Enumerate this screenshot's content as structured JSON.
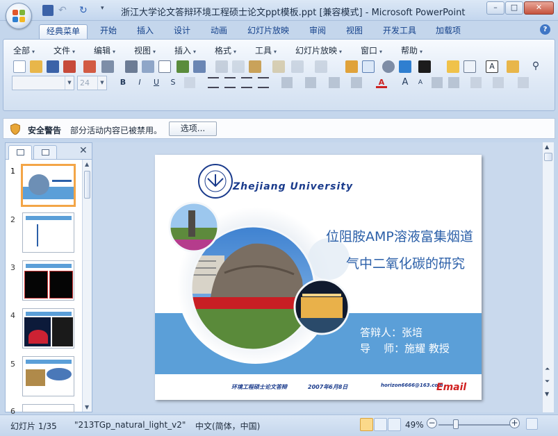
{
  "window": {
    "title": "浙江大学论文答辩环境工程硕士论文ppt模板.ppt [兼容模式] - Microsoft PowerPoint",
    "minimize": "–",
    "maximize": "□",
    "close": "✕"
  },
  "ribbon_tabs": [
    "经典菜单",
    "开始",
    "插入",
    "设计",
    "动画",
    "幻灯片放映",
    "审阅",
    "视图",
    "开发工具",
    "加载项"
  ],
  "help_glyph": "?",
  "classic_menu": [
    "全部",
    "文件",
    "编辑",
    "视图",
    "插入",
    "格式",
    "工具",
    "幻灯片放映",
    "窗口",
    "帮助"
  ],
  "font_size_field": "24",
  "format_buttons": [
    "B",
    "I",
    "U",
    "S",
    "A"
  ],
  "security_bar": {
    "title": "安全警告",
    "message": "部分活动内容已被禁用。",
    "options_button": "选项...",
    "close": "✕"
  },
  "slides_panel": {
    "close": "✕",
    "thumbnails": [
      "1",
      "2",
      "3",
      "4",
      "5",
      "6"
    ]
  },
  "slide": {
    "university": "Zhejiang University",
    "title_line1": "位阻胺AMP溶液富集烟道",
    "title_line2": "气中二氧化碳的研究",
    "defender_label": "答辩人：",
    "defender_name": "张培",
    "advisor_label": "导    师：",
    "advisor_name": "施耀 教授",
    "footer_left": "环境工程硕士论文答辩",
    "footer_date": "2007年6月8日",
    "footer_email": "horizon6666@163.com",
    "email_word": "Email"
  },
  "status_bar": {
    "slide_counter": "幻灯片 1/35",
    "theme": "\"213TGp_natural_light_v2\"",
    "language": "中文(简体，中国)",
    "zoom": "49%",
    "zoom_minus": "−",
    "zoom_plus": "+"
  },
  "colors": {
    "ribbon_bg": "#c4d6ec",
    "slide_band_blue": "#5b9fd8",
    "slide_title_blue": "#2b5fa8",
    "email_red": "#d02020",
    "selection_orange": "#f3a547"
  }
}
